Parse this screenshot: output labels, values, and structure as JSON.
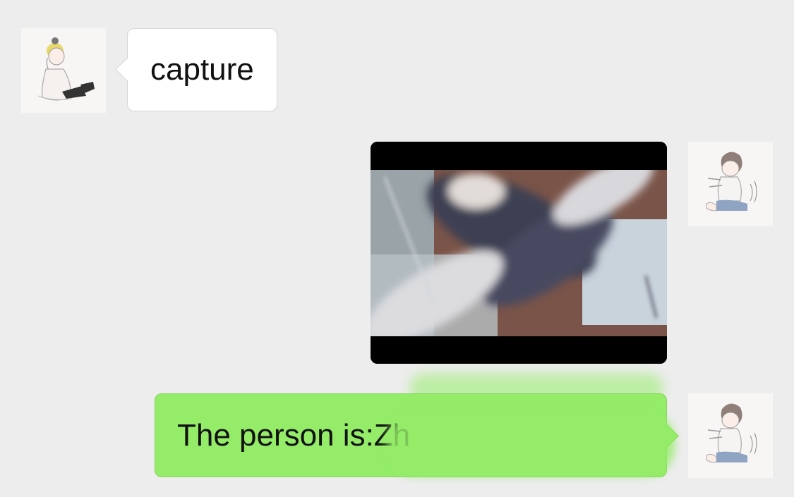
{
  "messages": [
    {
      "direction": "incoming",
      "type": "text",
      "text": "capture",
      "avatar_icon": "girl-with-yellow-hat-avatar-icon"
    },
    {
      "direction": "outgoing",
      "type": "image",
      "image_description": "blurred-scribbled-photo",
      "avatar_icon": "boy-sitting-avatar-icon"
    },
    {
      "direction": "outgoing",
      "type": "text",
      "text": "The person is:Zh",
      "avatar_icon": "boy-sitting-avatar-icon"
    }
  ],
  "colors": {
    "background": "#ededed",
    "incoming_bubble": "#ffffff",
    "outgoing_bubble": "#95ec69"
  }
}
